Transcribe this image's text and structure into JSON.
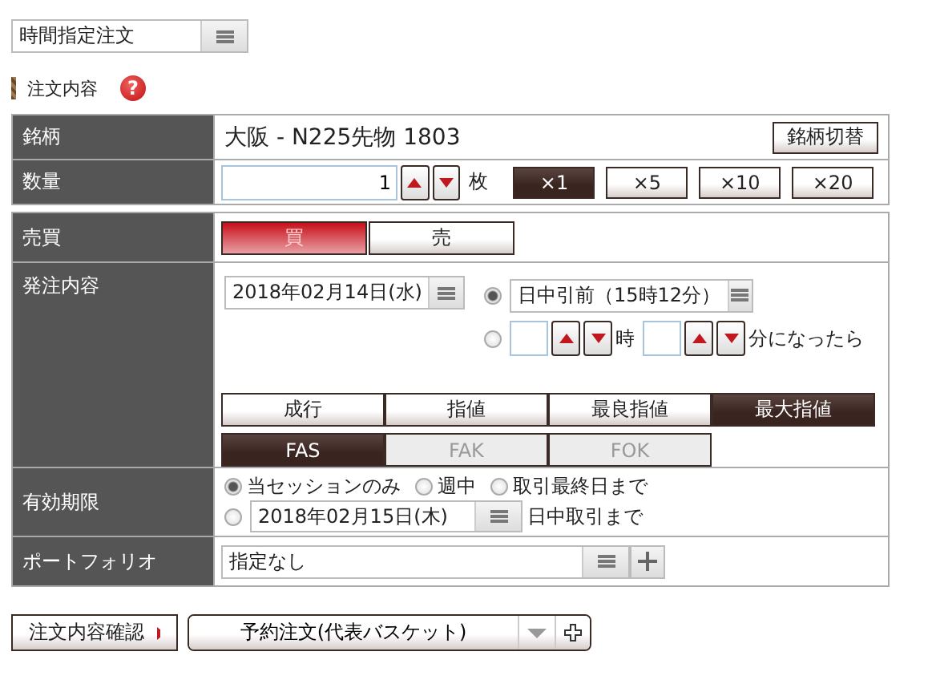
{
  "order_type": {
    "value": "時間指定注文"
  },
  "section": {
    "title": "注文内容",
    "help": "?"
  },
  "symbol": {
    "label": "銘柄",
    "value": "大阪 - N225先物 1803",
    "button": "銘柄切替"
  },
  "quantity": {
    "label": "数量",
    "value": "1",
    "unit": "枚",
    "multipliers": [
      {
        "label": "×1",
        "selected": true
      },
      {
        "label": "×5",
        "selected": false
      },
      {
        "label": "×10",
        "selected": false
      },
      {
        "label": "×20",
        "selected": false
      }
    ]
  },
  "side": {
    "label": "売買",
    "options": [
      {
        "label": "買",
        "selected": true
      },
      {
        "label": "売",
        "selected": false
      }
    ]
  },
  "order": {
    "label": "発注内容",
    "date": "2018年02月14日(水)",
    "timing": [
      {
        "kind": "select",
        "selected": true,
        "value": "日中引前（15時12分）"
      },
      {
        "kind": "time",
        "selected": false,
        "hour_unit": "時",
        "suffix": "分になったら"
      }
    ],
    "price_types": [
      {
        "label": "成行",
        "selected": false
      },
      {
        "label": "指値",
        "selected": false
      },
      {
        "label": "最良指値",
        "selected": false
      },
      {
        "label": "最大指値",
        "selected": true
      }
    ],
    "conditions": [
      {
        "label": "FAS",
        "selected": true,
        "disabled": false
      },
      {
        "label": "FAK",
        "selected": false,
        "disabled": true
      },
      {
        "label": "FOK",
        "selected": false,
        "disabled": true
      }
    ]
  },
  "validity": {
    "label": "有効期限",
    "options": [
      {
        "kind": "plain",
        "label": "当セッションのみ",
        "selected": true
      },
      {
        "kind": "plain",
        "label": "週中",
        "selected": false
      },
      {
        "kind": "plain",
        "label": "取引最終日まで",
        "selected": false
      },
      {
        "kind": "date",
        "date": "2018年02月15日(木)",
        "label": "日中取引まで",
        "selected": false
      }
    ]
  },
  "portfolio": {
    "label": "ポートフォリオ",
    "value": "指定なし"
  },
  "footer": {
    "confirm": "注文内容確認",
    "basket": "予約注文(代表バスケット)"
  }
}
